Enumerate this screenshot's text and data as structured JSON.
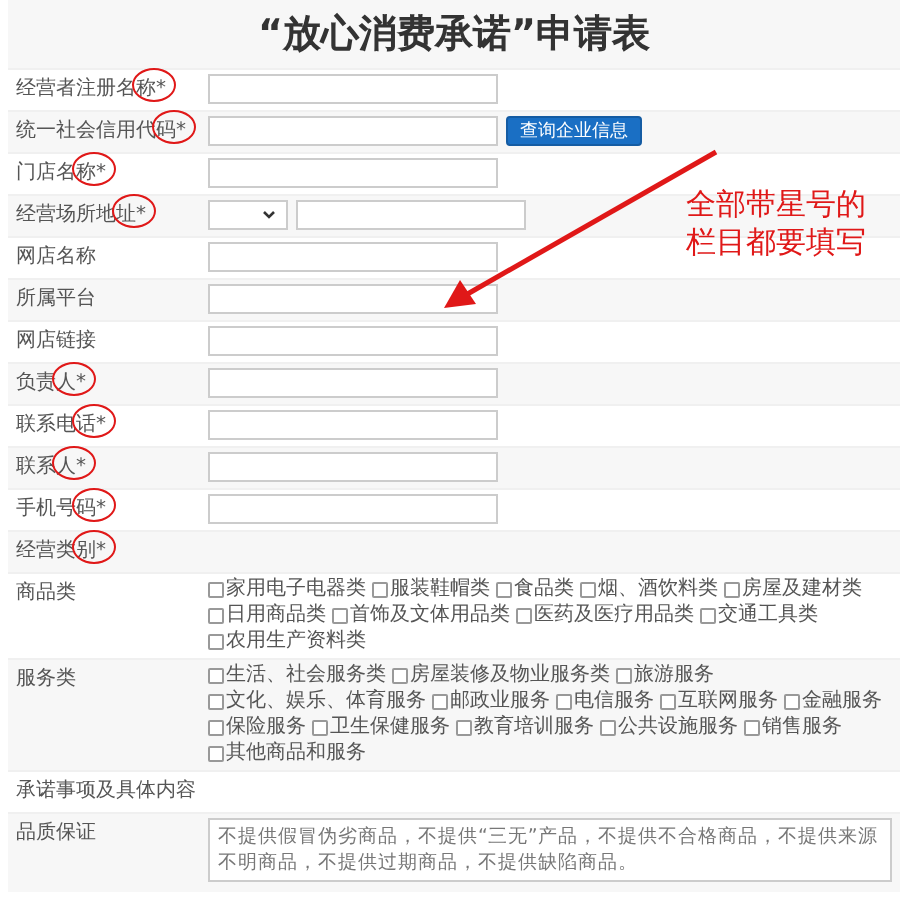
{
  "title": "“放心消费承诺”申请表",
  "rows": [
    {
      "label": "经营者注册名称*",
      "kind": "input",
      "circled": true
    },
    {
      "label": "统一社会信用代码*",
      "kind": "input-button",
      "button": "查询企业信息",
      "circled": true
    },
    {
      "label": "门店名称*",
      "kind": "input",
      "circled": true
    },
    {
      "label": "经营场所地址*",
      "kind": "address",
      "circled": true
    },
    {
      "label": "网店名称",
      "kind": "input",
      "circled": false
    },
    {
      "label": "所属平台",
      "kind": "input",
      "circled": false
    },
    {
      "label": "网店链接",
      "kind": "input",
      "circled": false
    },
    {
      "label": "负责人*",
      "kind": "input",
      "circled": true
    },
    {
      "label": "联系电话*",
      "kind": "input",
      "circled": true
    },
    {
      "label": "联系人*",
      "kind": "input",
      "circled": true
    },
    {
      "label": "手机号码*",
      "kind": "input",
      "circled": true
    },
    {
      "label": "经营类别*",
      "kind": "heading",
      "circled": true
    },
    {
      "label": "商品类",
      "kind": "checkboxes",
      "circled": false,
      "options": [
        {
          "text": "家用电子电器类",
          "checked": false
        },
        {
          "text": "服装鞋帽类",
          "checked": false
        },
        {
          "text": "食品类",
          "checked": false
        },
        {
          "text": "烟、酒饮料类",
          "checked": false
        },
        {
          "text": "房屋及建材类",
          "checked": false
        },
        {
          "text": "日用商品类",
          "checked": false
        },
        {
          "text": "首饰及文体用品类",
          "checked": false
        },
        {
          "text": "医药及医疗用品类",
          "checked": false
        },
        {
          "text": "交通工具类",
          "checked": false
        },
        {
          "text": "农用生产资料类",
          "checked": false
        }
      ]
    },
    {
      "label": "服务类",
      "kind": "checkboxes",
      "circled": false,
      "options": [
        {
          "text": "生活、社会服务类",
          "checked": false
        },
        {
          "text": "房屋装修及物业服务类",
          "checked": false
        },
        {
          "text": "旅游服务",
          "checked": false
        },
        {
          "text": "文化、娱乐、体育服务",
          "checked": false
        },
        {
          "text": "邮政业服务",
          "checked": false
        },
        {
          "text": "电信服务",
          "checked": false
        },
        {
          "text": "互联网服务",
          "checked": false
        },
        {
          "text": "金融服务",
          "checked": false
        },
        {
          "text": "保险服务",
          "checked": false
        },
        {
          "text": "卫生保健服务",
          "checked": false
        },
        {
          "text": "教育培训服务",
          "checked": false
        },
        {
          "text": "公共设施服务",
          "checked": false
        },
        {
          "text": "销售服务",
          "checked": false
        },
        {
          "text": "其他商品和服务",
          "checked": false
        }
      ]
    },
    {
      "label": "承诺事项及具体内容",
      "kind": "heading",
      "circled": false
    },
    {
      "label": "品质保证",
      "kind": "textarea",
      "circled": false,
      "value": "不提供假冒伪劣商品，不提供“三无”产品，不提供不合格商品，不提供来源不明商品，不提供过期商品，不提供缺陷商品。"
    }
  ],
  "annotation": {
    "note": "全部带星号的栏目都要填写"
  }
}
